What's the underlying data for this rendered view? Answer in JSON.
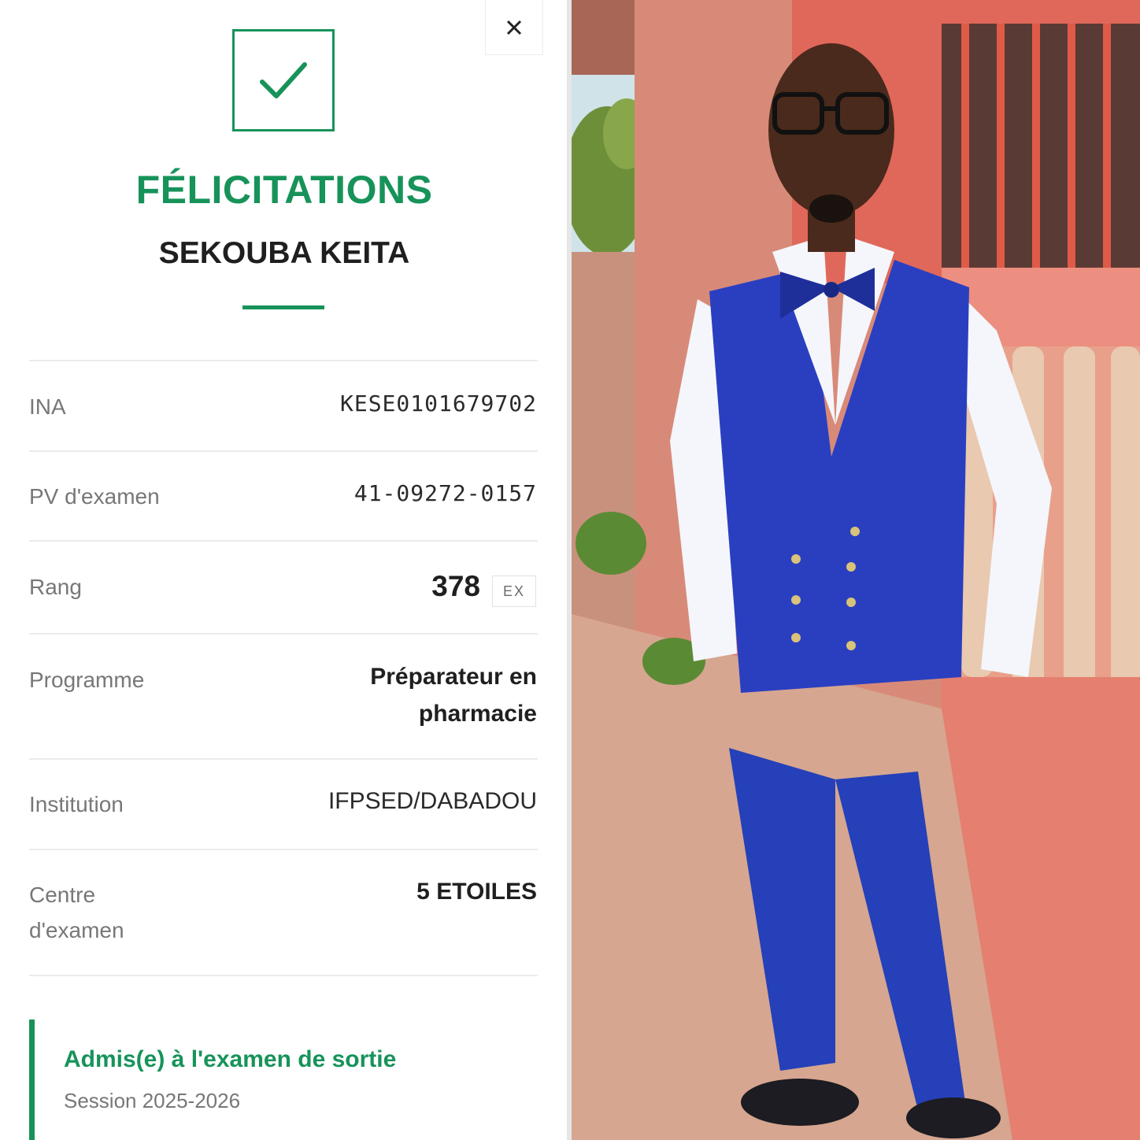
{
  "result_card": {
    "close_icon": "close-icon",
    "check_icon": "checkmark-icon",
    "title": "FÉLICITATIONS",
    "student_name": "SEKOUBA KEITA",
    "fields": {
      "ina": {
        "label": "INA",
        "value": "KESE0101679702"
      },
      "pv": {
        "label": "PV d'examen",
        "value": "41-09272-0157"
      },
      "rank": {
        "label": "Rang",
        "value": "378",
        "badge": "EX"
      },
      "program": {
        "label": "Programme",
        "value_line1": "Préparateur en",
        "value_line2": "pharmacie"
      },
      "institution": {
        "label": "Institution",
        "value": "IFPSED/DABADOU"
      },
      "center": {
        "label_line1": "Centre",
        "label_line2": "d'examen",
        "value": "5 ETOILES"
      }
    },
    "status": {
      "title": "Admis(e) à l'examen de sortie",
      "session": "Session 2025-2026"
    }
  },
  "colors": {
    "accent": "#17935a",
    "text_dark": "#1f1f1f",
    "text_muted": "#777777",
    "divider": "#ebebeb"
  },
  "photo": {
    "subject": "student-portrait"
  }
}
